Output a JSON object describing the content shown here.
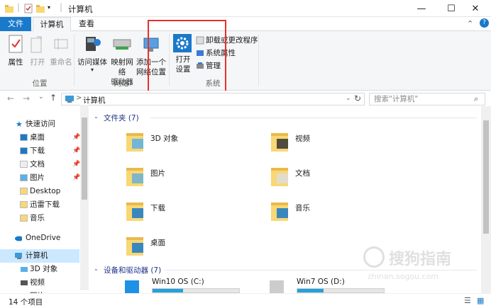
{
  "window": {
    "title": "计算机",
    "minimize": "—",
    "maximize": "☐",
    "close": "✕",
    "chevron": "⌃",
    "help": "?"
  },
  "tabs": {
    "file": "文件",
    "computer": "计算机",
    "view": "查看"
  },
  "ribbon": {
    "location": {
      "properties": "属性",
      "open": "打开",
      "rename": "重命名",
      "group": "位置"
    },
    "network": {
      "media_line1": "访问媒体",
      "map_line1": "映射网络",
      "map_line2": "驱动器",
      "add_line1": "添加一个",
      "add_line2": "网络位置",
      "group": "网络"
    },
    "system": {
      "open_settings_line1": "打开",
      "open_settings_line2": "设置",
      "uninstall": "卸载或更改程序",
      "sys_props": "系统属性",
      "manage": "管理",
      "group": "系统"
    }
  },
  "address": {
    "back": "←",
    "forward": "→",
    "recent": "⌄",
    "up": "↑",
    "path": "计算机",
    "separator": ">",
    "refresh": "↻",
    "search_placeholder": "搜索\"计算机\""
  },
  "nav": {
    "quick_access": "快速访问",
    "items": [
      {
        "label": "桌面",
        "pinned": true
      },
      {
        "label": "下载",
        "pinned": true
      },
      {
        "label": "文档",
        "pinned": true
      },
      {
        "label": "图片",
        "pinned": true
      },
      {
        "label": "Desktop",
        "pinned": false
      },
      {
        "label": "迅雷下载",
        "pinned": false
      },
      {
        "label": "音乐",
        "pinned": false
      }
    ],
    "onedrive": "OneDrive",
    "computer": "计算机",
    "sub": [
      "3D 对象",
      "视频",
      "图片"
    ]
  },
  "content": {
    "folders_header": "文件夹 (7)",
    "folders": [
      "3D 对象",
      "视频",
      "图片",
      "文档",
      "下载",
      "音乐",
      "桌面"
    ],
    "drives_header": "设备和驱动器 (7)",
    "drives": [
      {
        "label": "Win10 OS (C:)",
        "used_fraction": 0.35
      },
      {
        "label": "Win7 OS (D:)",
        "used_fraction": 0.3
      }
    ]
  },
  "status": {
    "items": "14 个项目"
  },
  "watermark": {
    "brand": "搜狗指南",
    "url": "zhinan.sogou.com"
  },
  "colors": {
    "accent": "#1979ca",
    "highlight": "#e8302a",
    "folder": "#f8d775"
  }
}
